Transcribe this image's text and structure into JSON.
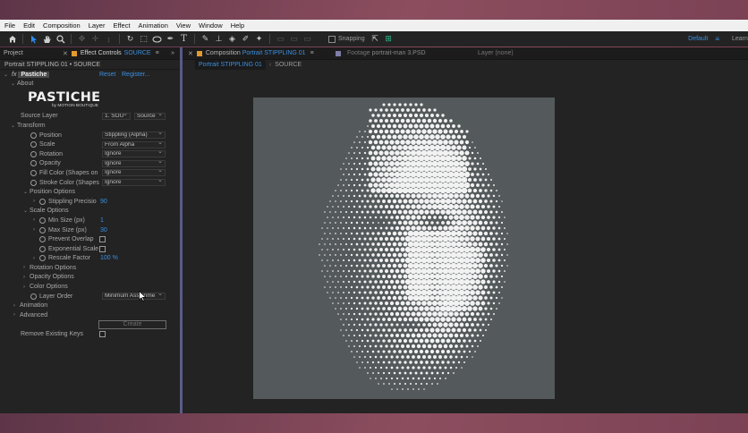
{
  "menubar": [
    "File",
    "Edit",
    "Composition",
    "Layer",
    "Effect",
    "Animation",
    "View",
    "Window",
    "Help"
  ],
  "toolbar": {
    "snapping_label": "Snapping",
    "workspace": "Default",
    "workspace_menu": "≡",
    "learn": "Learn"
  },
  "left_panel": {
    "tab_project": "Project",
    "tab_effect_controls": "Effect Controls",
    "tab_source": "SOURCE",
    "header": "Portrait STIPPLING 01 • SOURCE",
    "effect": {
      "fx_label": "fx",
      "name": "Pastiche",
      "reset": "Reset",
      "register": "Register..."
    },
    "about": "About",
    "logo": {
      "main": "PASTICHE",
      "sub": "by MOTION BOUTIQUE"
    },
    "source_layer": {
      "label": "Source Layer",
      "value1": "1. SOU",
      "value2": "Source"
    },
    "transform": {
      "label": "Transform",
      "rows": [
        {
          "label": "Position",
          "value": "Stippling (Alpha)"
        },
        {
          "label": "Scale",
          "value": "From Alpha"
        },
        {
          "label": "Rotation",
          "value": "Ignore"
        },
        {
          "label": "Opacity",
          "value": "Ignore"
        },
        {
          "label": "Fill Color (Shapes on",
          "value": "Ignore"
        },
        {
          "label": "Stroke Color (Shapes",
          "value": "Ignore"
        }
      ]
    },
    "position_options": {
      "label": "Position Options",
      "precision_label": "Stippling Precisio",
      "precision_value": "90"
    },
    "scale_options": {
      "label": "Scale Options",
      "min_label": "Min Size (px)",
      "min_value": "1",
      "max_label": "Max Size (px)",
      "max_value": "30",
      "prevent_overlap": "Prevent Overlap",
      "exponential": "Exponential Scale",
      "rescale_label": "Rescale Factor",
      "rescale_value": "100 %"
    },
    "rotation_options": "Rotation Options",
    "opacity_options": "Opacity Options",
    "color_options": "Color Options",
    "layer_order": {
      "label": "Layer Order",
      "value": "Minimum Assignme"
    },
    "animation": "Animation",
    "advanced": "Advanced",
    "create": "Create",
    "remove_existing_keys": "Remove Existing Keys"
  },
  "comp_panel": {
    "tab_label": "Composition",
    "tab_comp": "Portrait STIPPLING 01",
    "footage_label": "Footage",
    "footage_name": "portrait-man 3.PSD",
    "layer_label": "Layer (none)",
    "sub_active": "Portrait STIPPLING 01",
    "sub_other": "SOURCE"
  }
}
